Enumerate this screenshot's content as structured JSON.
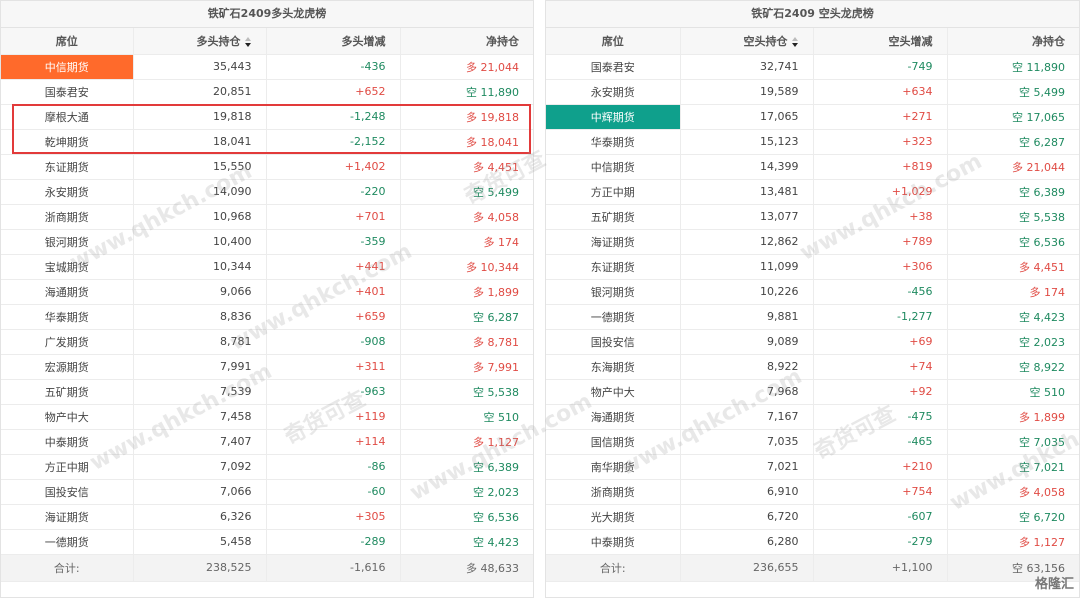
{
  "left": {
    "title": "铁矿石2409多头龙虎榜",
    "headers": [
      "席位",
      "多头持仓",
      "多头增减",
      "净持仓"
    ],
    "rows": [
      {
        "seat": "中信期货",
        "pos": "35,443",
        "chg": "-436",
        "net": "多 21,044"
      },
      {
        "seat": "国泰君安",
        "pos": "20,851",
        "chg": "+652",
        "net": "空 11,890"
      },
      {
        "seat": "摩根大通",
        "pos": "19,818",
        "chg": "-1,248",
        "net": "多 19,818"
      },
      {
        "seat": "乾坤期货",
        "pos": "18,041",
        "chg": "-2,152",
        "net": "多 18,041"
      },
      {
        "seat": "东证期货",
        "pos": "15,550",
        "chg": "+1,402",
        "net": "多 4,451"
      },
      {
        "seat": "永安期货",
        "pos": "14,090",
        "chg": "-220",
        "net": "空 5,499"
      },
      {
        "seat": "浙商期货",
        "pos": "10,968",
        "chg": "+701",
        "net": "多 4,058"
      },
      {
        "seat": "银河期货",
        "pos": "10,400",
        "chg": "-359",
        "net": "多 174"
      },
      {
        "seat": "宝城期货",
        "pos": "10,344",
        "chg": "+441",
        "net": "多 10,344"
      },
      {
        "seat": "海通期货",
        "pos": "9,066",
        "chg": "+401",
        "net": "多 1,899"
      },
      {
        "seat": "华泰期货",
        "pos": "8,836",
        "chg": "+659",
        "net": "空 6,287"
      },
      {
        "seat": "广发期货",
        "pos": "8,781",
        "chg": "-908",
        "net": "多 8,781"
      },
      {
        "seat": "宏源期货",
        "pos": "7,991",
        "chg": "+311",
        "net": "多 7,991"
      },
      {
        "seat": "五矿期货",
        "pos": "7,539",
        "chg": "-963",
        "net": "空 5,538"
      },
      {
        "seat": "物产中大",
        "pos": "7,458",
        "chg": "+119",
        "net": "空 510"
      },
      {
        "seat": "中泰期货",
        "pos": "7,407",
        "chg": "+114",
        "net": "多 1,127"
      },
      {
        "seat": "方正中期",
        "pos": "7,092",
        "chg": "-86",
        "net": "空 6,389"
      },
      {
        "seat": "国投安信",
        "pos": "7,066",
        "chg": "-60",
        "net": "空 2,023"
      },
      {
        "seat": "海证期货",
        "pos": "6,326",
        "chg": "+305",
        "net": "空 6,536"
      },
      {
        "seat": "一德期货",
        "pos": "5,458",
        "chg": "-289",
        "net": "空 4,423"
      }
    ],
    "total": {
      "label": "合计:",
      "pos": "238,525",
      "chg": "-1,616",
      "net": "多 48,633"
    }
  },
  "right": {
    "title": "铁矿石2409 空头龙虎榜",
    "headers": [
      "席位",
      "空头持仓",
      "空头增减",
      "净持仓"
    ],
    "rows": [
      {
        "seat": "国泰君安",
        "pos": "32,741",
        "chg": "-749",
        "net": "空 11,890"
      },
      {
        "seat": "永安期货",
        "pos": "19,589",
        "chg": "+634",
        "net": "空 5,499"
      },
      {
        "seat": "中辉期货",
        "pos": "17,065",
        "chg": "+271",
        "net": "空 17,065"
      },
      {
        "seat": "华泰期货",
        "pos": "15,123",
        "chg": "+323",
        "net": "空 6,287"
      },
      {
        "seat": "中信期货",
        "pos": "14,399",
        "chg": "+819",
        "net": "多 21,044"
      },
      {
        "seat": "方正中期",
        "pos": "13,481",
        "chg": "+1,029",
        "net": "空 6,389"
      },
      {
        "seat": "五矿期货",
        "pos": "13,077",
        "chg": "+38",
        "net": "空 5,538"
      },
      {
        "seat": "海证期货",
        "pos": "12,862",
        "chg": "+789",
        "net": "空 6,536"
      },
      {
        "seat": "东证期货",
        "pos": "11,099",
        "chg": "+306",
        "net": "多 4,451"
      },
      {
        "seat": "银河期货",
        "pos": "10,226",
        "chg": "-456",
        "net": "多 174"
      },
      {
        "seat": "一德期货",
        "pos": "9,881",
        "chg": "-1,277",
        "net": "空 4,423"
      },
      {
        "seat": "国投安信",
        "pos": "9,089",
        "chg": "+69",
        "net": "空 2,023"
      },
      {
        "seat": "东海期货",
        "pos": "8,922",
        "chg": "+74",
        "net": "空 8,922"
      },
      {
        "seat": "物产中大",
        "pos": "7,968",
        "chg": "+92",
        "net": "空 510"
      },
      {
        "seat": "海通期货",
        "pos": "7,167",
        "chg": "-475",
        "net": "多 1,899"
      },
      {
        "seat": "国信期货",
        "pos": "7,035",
        "chg": "-465",
        "net": "空 7,035"
      },
      {
        "seat": "南华期货",
        "pos": "7,021",
        "chg": "+210",
        "net": "空 7,021"
      },
      {
        "seat": "浙商期货",
        "pos": "6,910",
        "chg": "+754",
        "net": "多 4,058"
      },
      {
        "seat": "光大期货",
        "pos": "6,720",
        "chg": "-607",
        "net": "空 6,720"
      },
      {
        "seat": "中泰期货",
        "pos": "6,280",
        "chg": "-279",
        "net": "多 1,127"
      }
    ],
    "total": {
      "label": "合计:",
      "pos": "236,655",
      "chg": "+1,100",
      "net": "空 63,156"
    }
  },
  "watermarks": {
    "domain": "www.qhkch.com",
    "brand": "奇货可查"
  },
  "logo": "格隆汇",
  "colors": {
    "long_red": "#e04b44",
    "short_green": "#1f8a60",
    "highlight_orange": "#ff6a2b",
    "highlight_teal": "#0fa08c"
  }
}
